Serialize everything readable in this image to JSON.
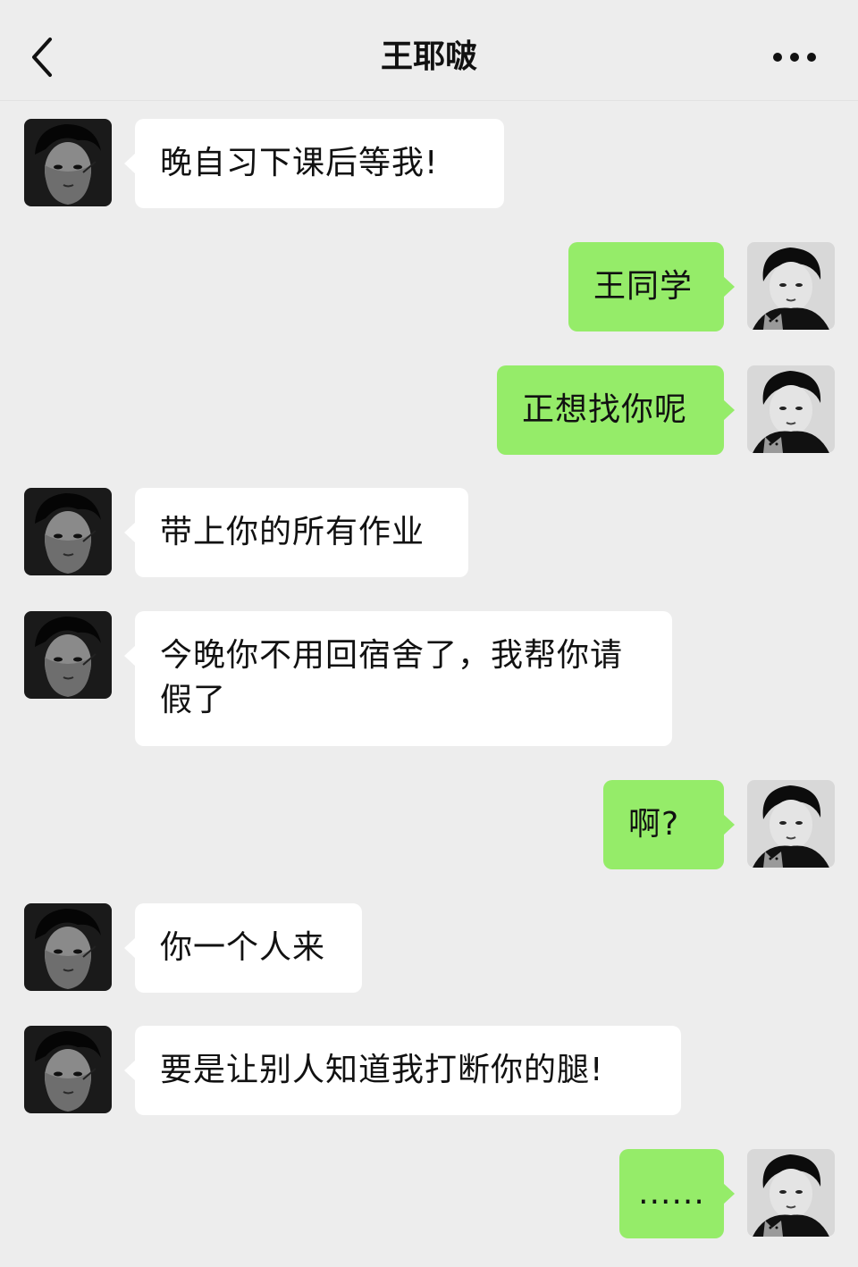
{
  "header": {
    "title": "王耶啵",
    "back_icon": "chevron-left-icon",
    "more_icon": "more-dots-icon"
  },
  "colors": {
    "background": "#ededed",
    "incoming_bubble": "#ffffff",
    "outgoing_bubble": "#95ec69"
  },
  "messages": [
    {
      "direction": "incoming",
      "text": "晚自习下课后等我!"
    },
    {
      "direction": "outgoing",
      "text": "王同学"
    },
    {
      "direction": "outgoing",
      "text": "正想找你呢"
    },
    {
      "direction": "incoming",
      "text": "带上你的所有作业"
    },
    {
      "direction": "incoming",
      "text": "今晚你不用回宿舍了，我帮你请假了"
    },
    {
      "direction": "outgoing",
      "text": "啊?"
    },
    {
      "direction": "incoming",
      "text": "你一个人来"
    },
    {
      "direction": "incoming",
      "text": "要是让别人知道我打断你的腿!"
    },
    {
      "direction": "outgoing",
      "text": "......"
    }
  ]
}
